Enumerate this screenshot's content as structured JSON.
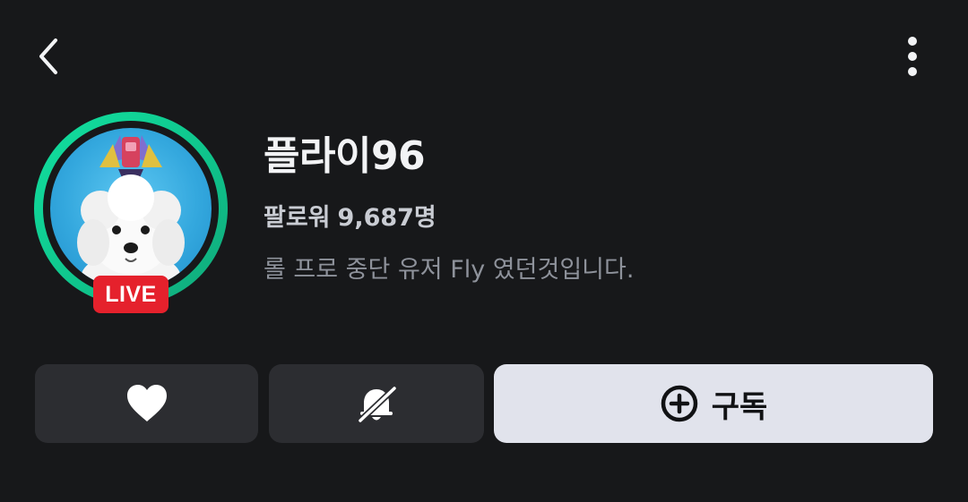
{
  "header": {
    "back_icon": "chevron-left-icon",
    "more_icon": "more-vertical-icon"
  },
  "profile": {
    "name": "플라이96",
    "followers_label": "팔로워",
    "followers_count": "9,687명",
    "bio": "롤 프로 중단 유저 Fly 였던것입니다.",
    "live_badge": "LIVE",
    "ring_color": "#12e0a0",
    "live_color": "#e5212c"
  },
  "actions": {
    "like_icon": "heart-icon",
    "notify_icon": "bell-off-icon",
    "subscribe_icon": "plus-circle-icon",
    "subscribe_label": "구독"
  }
}
